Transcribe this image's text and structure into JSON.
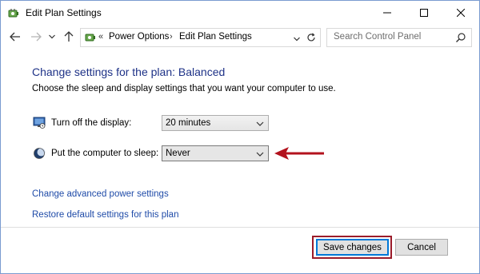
{
  "window": {
    "title": "Edit Plan Settings",
    "icons": {
      "app": "power-options-icon",
      "minimize": "minimize-icon",
      "maximize": "maximize-icon",
      "close": "close-icon"
    }
  },
  "nav": {
    "back_icon": "back-arrow-icon",
    "forward_icon": "forward-arrow-icon",
    "recent_icon": "chevron-down-icon",
    "up_icon": "up-arrow-icon",
    "breadcrumb": {
      "overflow": "«",
      "items": [
        {
          "label": "Power Options"
        },
        {
          "label": "Edit Plan Settings"
        }
      ],
      "separator": "›"
    },
    "refresh_icon": "refresh-icon",
    "search": {
      "placeholder": "Search Control Panel",
      "value": "",
      "icon": "search-icon"
    }
  },
  "main": {
    "heading": "Change settings for the plan: Balanced",
    "description": "Choose the sleep and display settings that you want your computer to use.",
    "settings": [
      {
        "label": "Turn off the display:",
        "value": "20 minutes",
        "icon": "monitor-icon"
      },
      {
        "label": "Put the computer to sleep:",
        "value": "Never",
        "icon": "moon-icon"
      }
    ],
    "links": [
      {
        "label": "Change advanced power settings"
      },
      {
        "label": "Restore default settings for this plan"
      }
    ]
  },
  "footer": {
    "save_label": "Save changes",
    "cancel_label": "Cancel"
  },
  "colors": {
    "heading": "#1e3287",
    "link": "#1f4ba8",
    "annotation_red": "#b3121d",
    "save_focus": "#0078d7"
  }
}
